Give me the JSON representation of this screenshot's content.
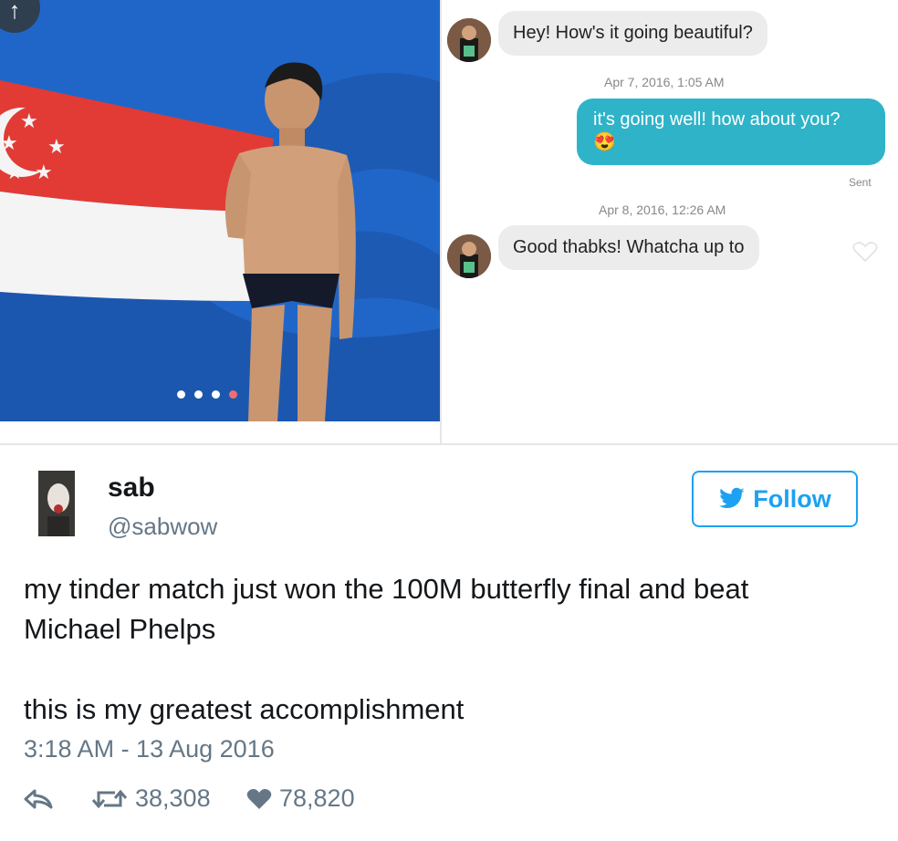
{
  "chat": {
    "messages": [
      {
        "from": "match",
        "text": "Hey! How's it going beautiful?"
      },
      {
        "timestamp": "Apr 7, 2016, 1:05 AM"
      },
      {
        "from": "me",
        "text": "it's going well! how about you?",
        "emoji": "😍",
        "status": "Sent"
      },
      {
        "timestamp": "Apr 8, 2016, 12:26 AM"
      },
      {
        "from": "match",
        "text": "Good thabks! Whatcha up to"
      }
    ],
    "photo_dots": 4,
    "photo_active_dot": 4
  },
  "tweet": {
    "name": "sab",
    "handle": "@sabwow",
    "follow_label": "Follow",
    "text_line1": "my tinder match just won the 100M butterfly final and beat Michael Phelps",
    "text_line2": "this is my greatest accomplishment",
    "timestamp": "3:18 AM - 13 Aug 2016",
    "retweets": "38,308",
    "likes": "78,820"
  },
  "colors": {
    "sent_bubble": "#2fb3c8",
    "received_bubble": "#ececec",
    "twitter_blue": "#1da1f2",
    "meta_gray": "#657786"
  },
  "icons": {
    "upload": "upload-icon",
    "like_message": "heart-outline-icon",
    "reply": "reply-icon",
    "retweet": "retweet-icon",
    "like": "heart-icon",
    "twitter": "twitter-bird-icon"
  }
}
